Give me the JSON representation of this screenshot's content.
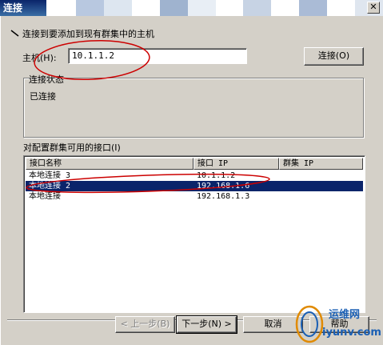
{
  "window": {
    "title": "连接"
  },
  "header": {
    "instruction": "连接到要添加到现有群集中的主机"
  },
  "host": {
    "label": "主机(H):",
    "value": "10.1.1.2",
    "connect_button": "连接(O)"
  },
  "status": {
    "group_label": "连接状态",
    "text": "已连接"
  },
  "interfaces": {
    "label": "对配置群集可用的接口(I)",
    "columns": [
      "接口名称",
      "接口 IP",
      "群集 IP"
    ],
    "rows": [
      {
        "name": "本地连接 3",
        "ip": "10.1.1.2",
        "cluster_ip": ""
      },
      {
        "name": "本地连接 2",
        "ip": "192.168.1.6",
        "cluster_ip": ""
      },
      {
        "name": "本地连接",
        "ip": "192.168.1.3",
        "cluster_ip": ""
      }
    ],
    "selected_index": 1
  },
  "footer": {
    "back_button": "< 上一步(B)",
    "next_button": "下一步(N) >",
    "cancel_button": "取消",
    "help_button": "帮助"
  },
  "watermark": {
    "text_cn": "运维网",
    "text_en": "iyunv.com"
  },
  "colors": {
    "dialog_bg": "#d4d0c8",
    "selection": "#0a246a",
    "annotation": "#cc0000",
    "watermark_blue": "#1a5fb4"
  }
}
